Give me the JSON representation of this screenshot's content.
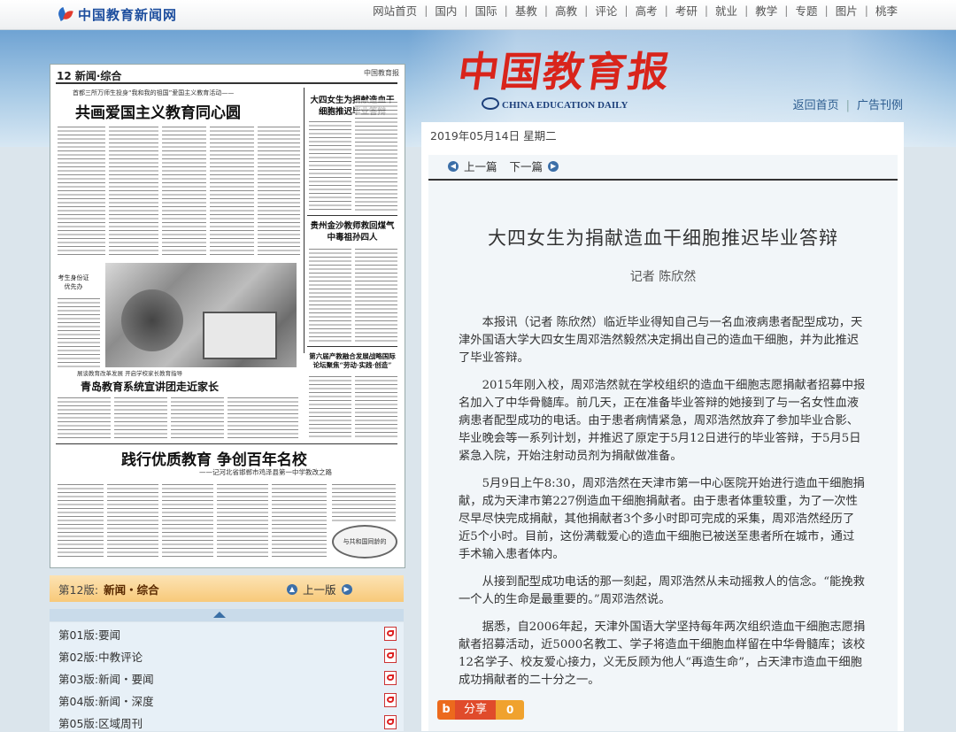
{
  "site": {
    "logo_text": "中国教育新闻网",
    "nav": [
      "网站首页",
      "国内",
      "国际",
      "基教",
      "高教",
      "评论",
      "高考",
      "考研",
      "就业",
      "教学",
      "专题",
      "图片",
      "桃李"
    ]
  },
  "masthead": {
    "title_cn": "中国教育报",
    "title_en": "CHINA EDUCATION DAILY",
    "links": [
      "返回首页",
      "广告刊例"
    ]
  },
  "date": "2019年05月14日  星期二",
  "article_nav": {
    "prev": "上一篇",
    "next": "下一篇"
  },
  "article": {
    "title": "大四女生为捐献造血干细胞推迟毕业答辩",
    "author": "记者  陈欣然",
    "paragraphs": [
      "本报讯（记者 陈欣然）临近毕业得知自己与一名血液病患者配型成功，天津外国语大学大四女生周邓浩然毅然决定捐出自己的造血干细胞，并为此推迟了毕业答辩。",
      "2015年刚入校，周邓浩然就在学校组织的造血干细胞志愿捐献者招募中报名加入了中华骨髓库。前几天，正在准备毕业答辩的她接到了与一名女性血液病患者配型成功的电话。由于患者病情紧急，周邓浩然放弃了参加毕业合影、毕业晚会等一系列计划，并推迟了原定于5月12日进行的毕业答辩，于5月5日紧急入院，开始注射动员剂为捐献做准备。",
      "5月9日上午8:30，周邓浩然在天津市第一中心医院开始进行造血干细胞捐献，成为天津市第227例造血干细胞捐献者。由于患者体重较重，为了一次性尽早尽快完成捐献，其他捐献者3个多小时即可完成的采集，周邓浩然经历了近5个小时。目前，这份满载爱心的造血干细胞已被送至患者所在城市，通过手术输入患者体内。",
      "从接到配型成功电话的那一刻起，周邓浩然从未动摇救人的信念。“能挽救一个人的生命是最重要的。”周邓浩然说。",
      "据悉，自2006年起，天津外国语大学坚持每年两次组织造血干细胞志愿捐献者招募活动，近5000名教工、学子将造血干细胞血样留在中华骨髓库；该校12名学子、校友爱心接力，义无反顾为他人“再造生命”，占天津市造血干细胞成功捐献者的二十分之一。"
    ]
  },
  "share": {
    "icon": "b",
    "label": "分享",
    "count": "0"
  },
  "newspaper": {
    "page_head": "12 新闻·综合",
    "page_head_right": "中国教育报",
    "kicker": "首都三所万师生投身“我和我的祖国”爱国主义教育活动——",
    "headline_main": "共画爱国主义教育同心圆",
    "headline_right1": "大四女生为捐献造血干细胞推迟毕业答辩",
    "headline_right2": "贵州金沙教师救回煤气中毒祖孙四人",
    "headline_right3": "第六届产教融合发展战略国际论坛聚焦“劳动·实践·创造”",
    "kicker2": "展谈教育改革发展  开启学校家长教育指导",
    "headline_mid": "青岛教育系统宣讲团走近家长",
    "sidebar_note": "考生身份证优先办",
    "headline_bottom": "践行优质教育  争创百年名校",
    "sub_bottom": "——记河北省邯郸市鸡泽县第一中学教改之路",
    "seal_text": "与共和国同龄的"
  },
  "edition": {
    "current_prefix": "第12版:",
    "current_name": "新闻・综合",
    "prev_label": "上一版",
    "list": [
      {
        "num": "第01版:",
        "name": "要闻"
      },
      {
        "num": "第02版:",
        "name": "中教评论"
      },
      {
        "num": "第03版:",
        "name": "新闻・要闻"
      },
      {
        "num": "第04版:",
        "name": "新闻・深度"
      },
      {
        "num": "第05版:",
        "name": "区域周刊"
      }
    ]
  },
  "colors": {
    "accent_red": "#d9241b",
    "nav_blue": "#2c5c8f",
    "edition_bar": "#f8c979"
  }
}
